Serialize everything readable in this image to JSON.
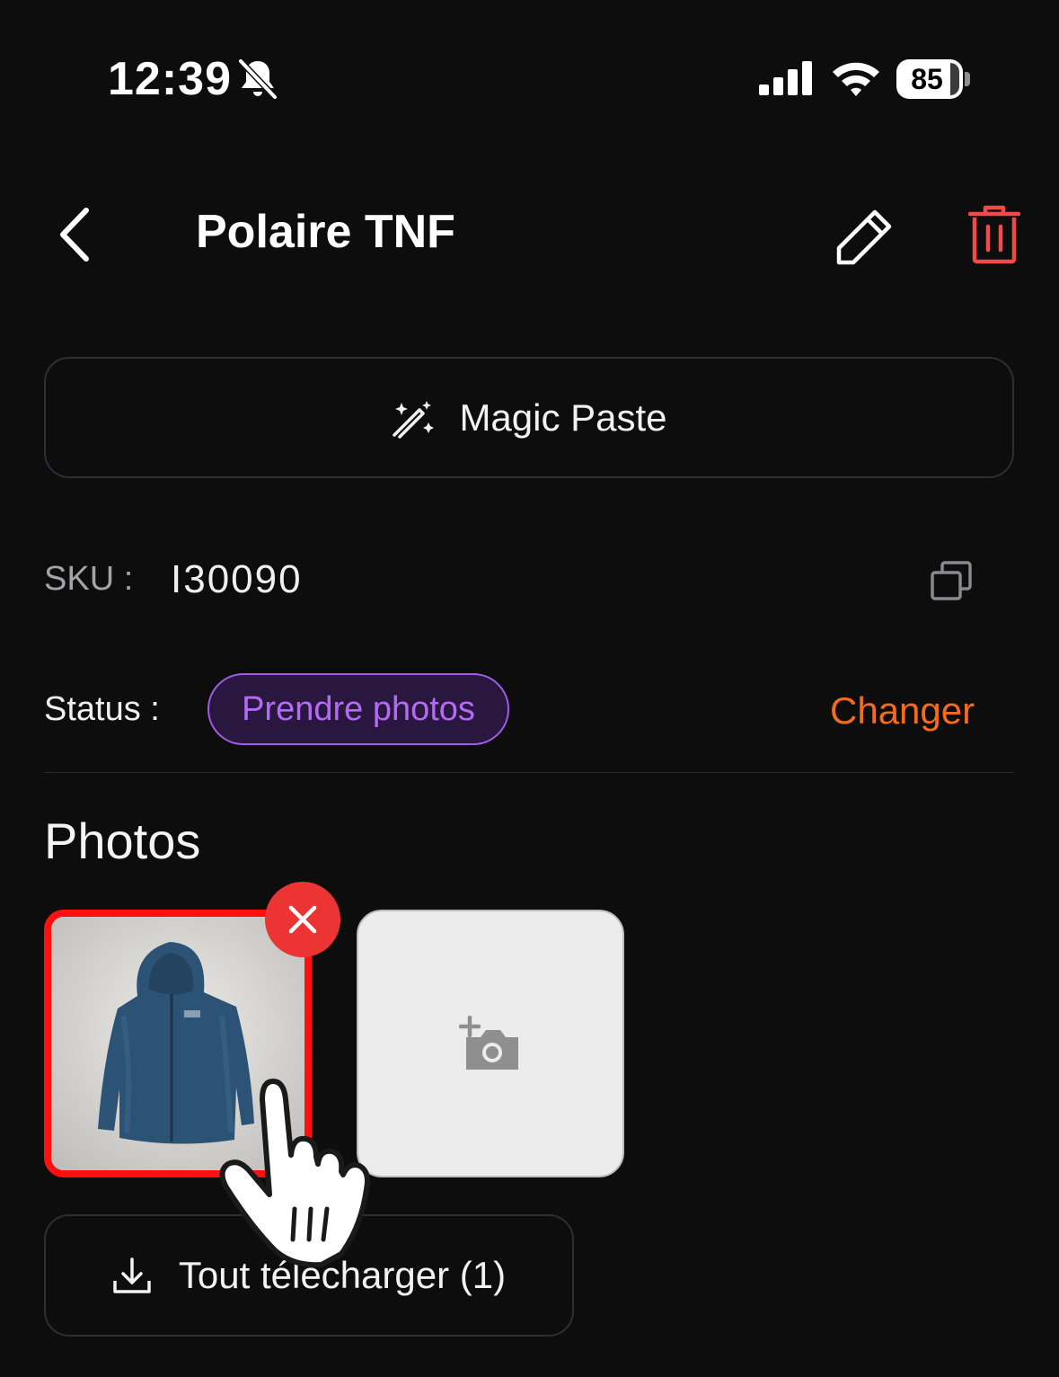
{
  "status_bar": {
    "time": "12:39",
    "silent_icon": "bell-slash-icon",
    "signal_icon": "cellular-signal-icon",
    "wifi_icon": "wifi-icon",
    "battery": "85"
  },
  "header": {
    "title": "Polaire TNF",
    "back_icon": "chevron-left-icon",
    "edit_icon": "pencil-icon",
    "delete_icon": "trash-icon"
  },
  "magic_paste": {
    "label": "Magic Paste",
    "icon": "magic-wand-icon"
  },
  "sku": {
    "label": "SKU :",
    "value": "I30090",
    "copy_icon": "copy-icon"
  },
  "status": {
    "label": "Status :",
    "value": "Prendre photos",
    "change_label": "Changer"
  },
  "photos": {
    "title": "Photos",
    "items": [
      {
        "alt": "blue-fleece-jacket-photo",
        "selected": true
      }
    ],
    "remove_icon": "close-icon",
    "add_icon": "add-photo-camera-icon"
  },
  "download": {
    "label": "Tout télécharger (1)",
    "icon": "download-icon"
  },
  "colors": {
    "background": "#0d0d0e",
    "delete": "#f04a4a",
    "status_pill_border": "#a15de8",
    "status_pill_text": "#b46af5",
    "change": "#f36b1c",
    "photo_selected_border": "#ff1010"
  }
}
